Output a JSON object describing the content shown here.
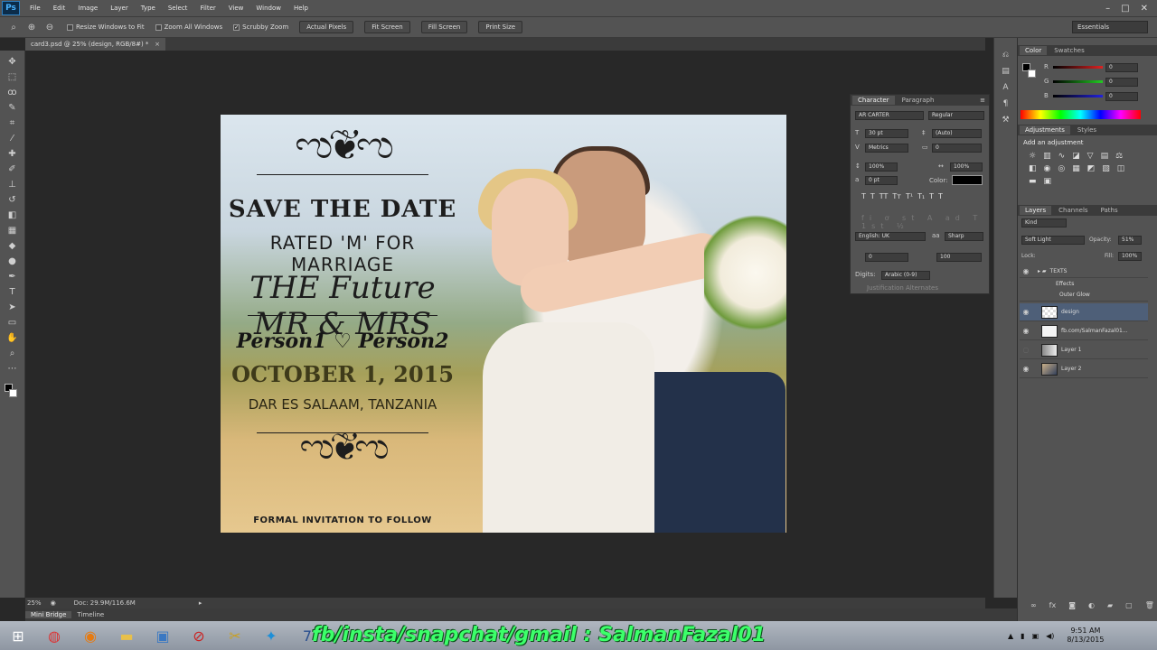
{
  "app": {
    "logo": "Ps"
  },
  "menu": [
    "File",
    "Edit",
    "Image",
    "Layer",
    "Type",
    "Select",
    "Filter",
    "View",
    "Window",
    "Help"
  ],
  "window_controls": [
    "–",
    "□",
    "✕"
  ],
  "options_bar": {
    "resize_windows": "Resize Windows to Fit",
    "zoom_all": "Zoom All Windows",
    "scrubby_zoom": "Scrubby Zoom",
    "actual_pixels": "Actual Pixels",
    "fit_screen": "Fit Screen",
    "fill_screen": "Fill Screen",
    "print_size": "Print Size",
    "workspace": "Essentials"
  },
  "document": {
    "tab_title": "card3.psd @ 25% (design, RGB/8#) *",
    "close": "×"
  },
  "artwork": {
    "save": "SAVE THE DATE",
    "rated": "RATED 'M' FOR MARRIAGE",
    "future": "THE Future MR & MRS",
    "names": "Person1 ♡ Person2",
    "date": "OCTOBER 1, 2015",
    "place": "DAR ES SALAAM, TANZANIA",
    "formal": "FORMAL INVITATION TO FOLLOW",
    "flourish_top": "ಌ❦ಌ",
    "flourish_bottom": "ಌ❦ಌ"
  },
  "character_panel": {
    "tabs": [
      "Character",
      "Paragraph"
    ],
    "font": "AR CARTER",
    "style": "Regular",
    "size": "30 pt",
    "leading": "(Auto)",
    "kerning": "Metrics",
    "tracking": "0",
    "vscale": "100%",
    "hscale": "100%",
    "baseline": "0 pt",
    "color_label": "Color:",
    "type_buttons": [
      "T",
      "T",
      "TT",
      "Tт",
      "T¹",
      "T₁",
      "T",
      "T"
    ],
    "language": "English: UK",
    "aa": "Sharp",
    "aa_label": "aa",
    "extra1": "0",
    "extra2": "100",
    "digits_label": "Digits:",
    "digits": "Arabic (0-9)",
    "justification": "Justification Alternates"
  },
  "color_panel": {
    "tabs": [
      "Color",
      "Swatches"
    ],
    "channels": [
      {
        "label": "R",
        "value": "0",
        "color": "#d22"
      },
      {
        "label": "G",
        "value": "0",
        "color": "#2c2"
      },
      {
        "label": "B",
        "value": "0",
        "color": "#22d"
      }
    ]
  },
  "adjustments_panel": {
    "tabs": [
      "Adjustments",
      "Styles"
    ],
    "heading": "Add an adjustment"
  },
  "layers_panel": {
    "tabs": [
      "Layers",
      "Channels",
      "Paths"
    ],
    "kind": "Kind",
    "blend_mode": "Soft Light",
    "opacity_label": "Opacity:",
    "opacity": "51%",
    "lock_label": "Lock:",
    "fill_label": "Fill:",
    "fill": "100%",
    "layers": [
      {
        "name": "TEXTS",
        "type": "group"
      },
      {
        "name": "Effects",
        "type": "sub"
      },
      {
        "name": "Outer Glow",
        "type": "sub"
      },
      {
        "name": "design",
        "type": "layer",
        "selected": true
      },
      {
        "name": "fb.com/SalmanFazal01...",
        "type": "layer"
      },
      {
        "name": "Layer 1",
        "type": "layer"
      },
      {
        "name": "Layer 2",
        "type": "layer"
      }
    ]
  },
  "status": {
    "zoom": "25%",
    "doc": "Doc: 29.9M/116.6M"
  },
  "bottom_tabs": [
    "Mini Bridge",
    "Timeline"
  ],
  "overlay_text": "fb/insta/snapchat/gmail : SalmanFazal01",
  "clock": {
    "time": "9:51 AM",
    "date": "8/13/2015"
  },
  "colors": {
    "accent_green": "#3cff6a",
    "ui_gray": "#535353",
    "selection_blue": "#4e5f78"
  }
}
